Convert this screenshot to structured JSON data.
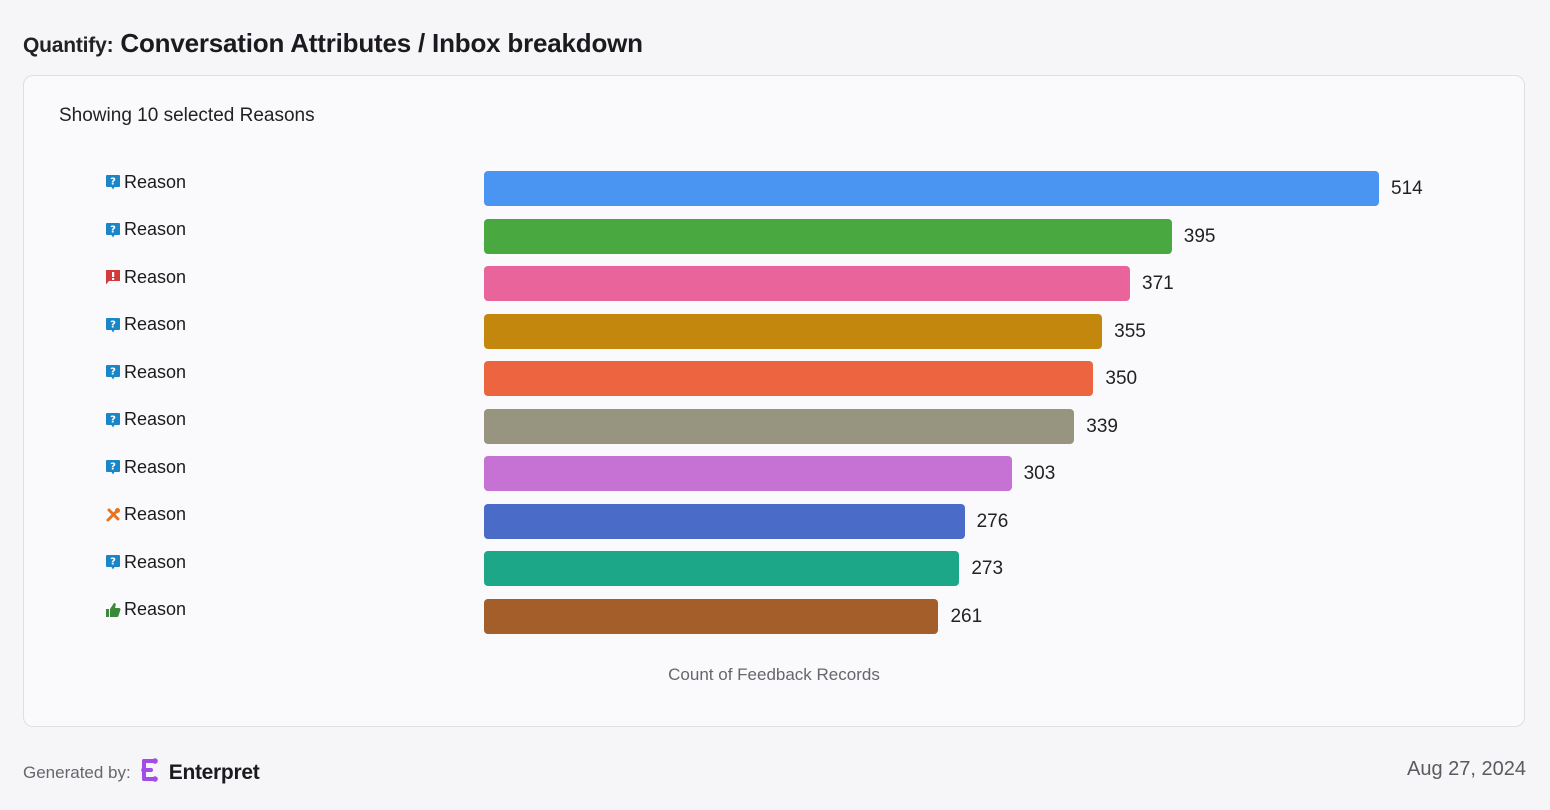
{
  "header": {
    "prefix": "Quantify:",
    "title": "Conversation Attributes / Inbox breakdown"
  },
  "card": {
    "subtitle": "Showing 10 selected Reasons"
  },
  "chart_data": {
    "type": "bar",
    "orientation": "horizontal",
    "title": "Showing 10 selected Reasons",
    "xlabel": "Count of Feedback Records",
    "ylabel": "",
    "xlim": [
      0,
      514
    ],
    "grid": false,
    "legend": "none",
    "categories": [
      "Reason",
      "Reason",
      "Reason",
      "Reason",
      "Reason",
      "Reason",
      "Reason",
      "Reason",
      "Reason",
      "Reason"
    ],
    "category_icons": [
      "question-bubble",
      "question-bubble",
      "exclamation-flag",
      "question-bubble",
      "question-bubble",
      "question-bubble",
      "question-bubble",
      "tools",
      "question-bubble",
      "thumbs-up"
    ],
    "values": [
      514,
      395,
      371,
      355,
      350,
      339,
      303,
      276,
      273,
      261
    ],
    "colors": [
      "#4a94f2",
      "#4aa840",
      "#e8649a",
      "#c4870e",
      "#ec6540",
      "#97957f",
      "#c672d4",
      "#4a6cc8",
      "#1ca888",
      "#a35e2a"
    ]
  },
  "icon_colors": {
    "question-bubble": "#1a86c8",
    "exclamation-flag": "#d13b3b",
    "tools": "#e8731c",
    "thumbs-up": "#3a8a3a"
  },
  "footer": {
    "generated_by": "Generated by:",
    "brand": "Enterpret",
    "brand_color": "#a24ee6",
    "date": "Aug 27, 2024"
  }
}
